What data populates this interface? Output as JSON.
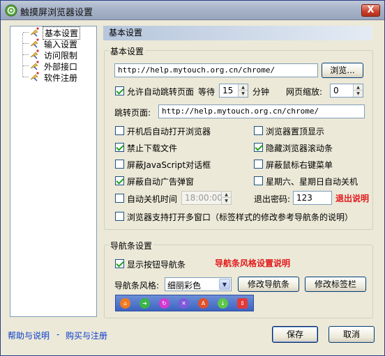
{
  "window": {
    "title": "触摸屏浏览器设置",
    "close_glyph": "X"
  },
  "tree": {
    "items": [
      {
        "label": "基本设置",
        "icon": "satellite-dish-icon"
      },
      {
        "label": "输入设置",
        "icon": "satellite-dish-icon"
      },
      {
        "label": "访问限制",
        "icon": "satellite-dish-icon"
      },
      {
        "label": "外部接口",
        "icon": "satellite-dish-icon"
      },
      {
        "label": "软件注册",
        "icon": "satellite-dish-icon"
      }
    ],
    "selected_index": 0
  },
  "panel": {
    "header": "基本设置",
    "basic_group": {
      "title": "基本设置",
      "homepage_url": "http://help.mytouch.org.cn/chrome/",
      "browse_button": "浏览...",
      "auto_jump_label": "允许自动跳转页面",
      "auto_jump_checked": true,
      "wait_label": "等待",
      "wait_value": "15",
      "minutes_label": "分钟",
      "zoom_label": "网页缩放:",
      "zoom_value": "0",
      "jump_page_label": "跳转页面:",
      "jump_page_url": "http://help.mytouch.org.cn/chrome/",
      "options": {
        "autostart": {
          "label": "开机后自动打开浏览器",
          "checked": false
        },
        "topmost": {
          "label": "浏览器置顶显示",
          "checked": false
        },
        "no_download": {
          "label": "禁止下载文件",
          "checked": true
        },
        "hide_scrollbar": {
          "label": "隐藏浏览器滚动条",
          "checked": true
        },
        "block_js_dialog": {
          "label": "屏蔽JavaScript对话框",
          "checked": false
        },
        "block_right_click": {
          "label": "屏蔽鼠标右键菜单",
          "checked": false
        },
        "block_popup": {
          "label": "屏蔽自动广告弹窗",
          "checked": true
        },
        "weekend_shutdown": {
          "label": "星期六、星期日自动关机",
          "checked": false
        },
        "auto_shutdown": {
          "label": "自动关机时间",
          "checked": false
        },
        "multi_window": {
          "label": "浏览器支持打开多窗口（标签样式的修改参考导航条的说明）",
          "checked": false
        }
      },
      "shutdown_time": "18:00:00",
      "exit_password_label": "退出密码:",
      "exit_password_value": "123",
      "exit_help_link": "退出说明"
    },
    "nav_group": {
      "title": "导航条设置",
      "show_nav_label": "显示按钮导航条",
      "show_nav_checked": true,
      "nav_help_link": "导航条风格设置说明",
      "style_label": "导航条风格:",
      "style_value": "细丽彩色",
      "modify_nav_button": "修改导航条",
      "modify_tab_button": "修改标签栏",
      "nav_buttons": [
        {
          "icon": "home-icon",
          "color": "#f07a1e"
        },
        {
          "icon": "forward-icon",
          "color": "#3ab54a"
        },
        {
          "icon": "refresh-icon",
          "color": "#d43ad0"
        },
        {
          "icon": "close-icon",
          "color": "#7f5ad8"
        },
        {
          "icon": "font-size-icon",
          "color": "#e0502a"
        },
        {
          "icon": "download-icon",
          "color": "#5cc84a"
        },
        {
          "icon": "scroll-arrows-icon",
          "color": "#e23a3a"
        }
      ]
    }
  },
  "footer": {
    "help_link": "帮助与说明",
    "separator": "-",
    "buy_link": "购买与注册",
    "save_button": "保存",
    "cancel_button": "取消"
  }
}
